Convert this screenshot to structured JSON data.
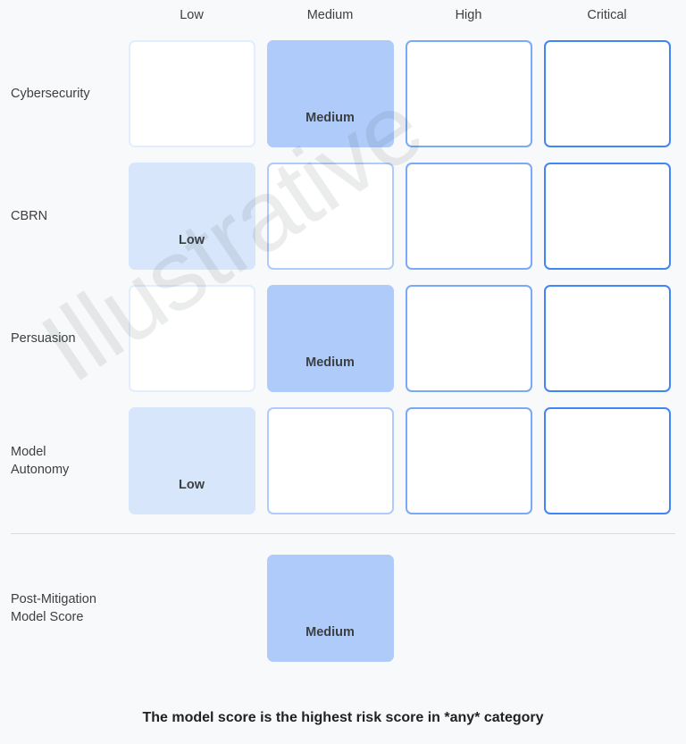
{
  "watermark": {
    "text": "Illustrative"
  },
  "columns": [
    {
      "label": "Low"
    },
    {
      "label": "Medium"
    },
    {
      "label": "High"
    },
    {
      "label": "Critical"
    }
  ],
  "rows": [
    {
      "label": "Cybersecurity",
      "cells": [
        {
          "label": "",
          "filled": "none"
        },
        {
          "label": "Medium",
          "filled": "medium"
        },
        {
          "label": "",
          "filled": "none"
        },
        {
          "label": "",
          "filled": "none"
        }
      ]
    },
    {
      "label": "CBRN",
      "cells": [
        {
          "label": "Low",
          "filled": "low"
        },
        {
          "label": "",
          "filled": "none"
        },
        {
          "label": "",
          "filled": "none"
        },
        {
          "label": "",
          "filled": "none"
        }
      ]
    },
    {
      "label": "Persuasion",
      "cells": [
        {
          "label": "",
          "filled": "none"
        },
        {
          "label": "Medium",
          "filled": "medium"
        },
        {
          "label": "",
          "filled": "none"
        },
        {
          "label": "",
          "filled": "none"
        }
      ]
    },
    {
      "label": "Model\nAutonomy",
      "cells": [
        {
          "label": "Low",
          "filled": "low"
        },
        {
          "label": "",
          "filled": "none"
        },
        {
          "label": "",
          "filled": "none"
        },
        {
          "label": "",
          "filled": "none"
        }
      ]
    }
  ],
  "summary": {
    "label": "Post-Mitigation\nModel Score",
    "score_column": "Medium",
    "score_label": "Medium"
  },
  "caption": {
    "text": "The model score is the highest risk score in *any* category"
  },
  "colors": {
    "background": "#f8f9fa",
    "text": "#3c4043",
    "caption_text": "#202124",
    "divider": "#dadce0",
    "fill_low": "#d7e6fb",
    "fill_medium": "#aecbfa",
    "border_low": "#e2edfd",
    "border_medium": "#aecbfa",
    "border_high": "#7aa9f7",
    "border_critical": "#4285f4",
    "watermark": "rgba(60,64,67,0.10)"
  }
}
